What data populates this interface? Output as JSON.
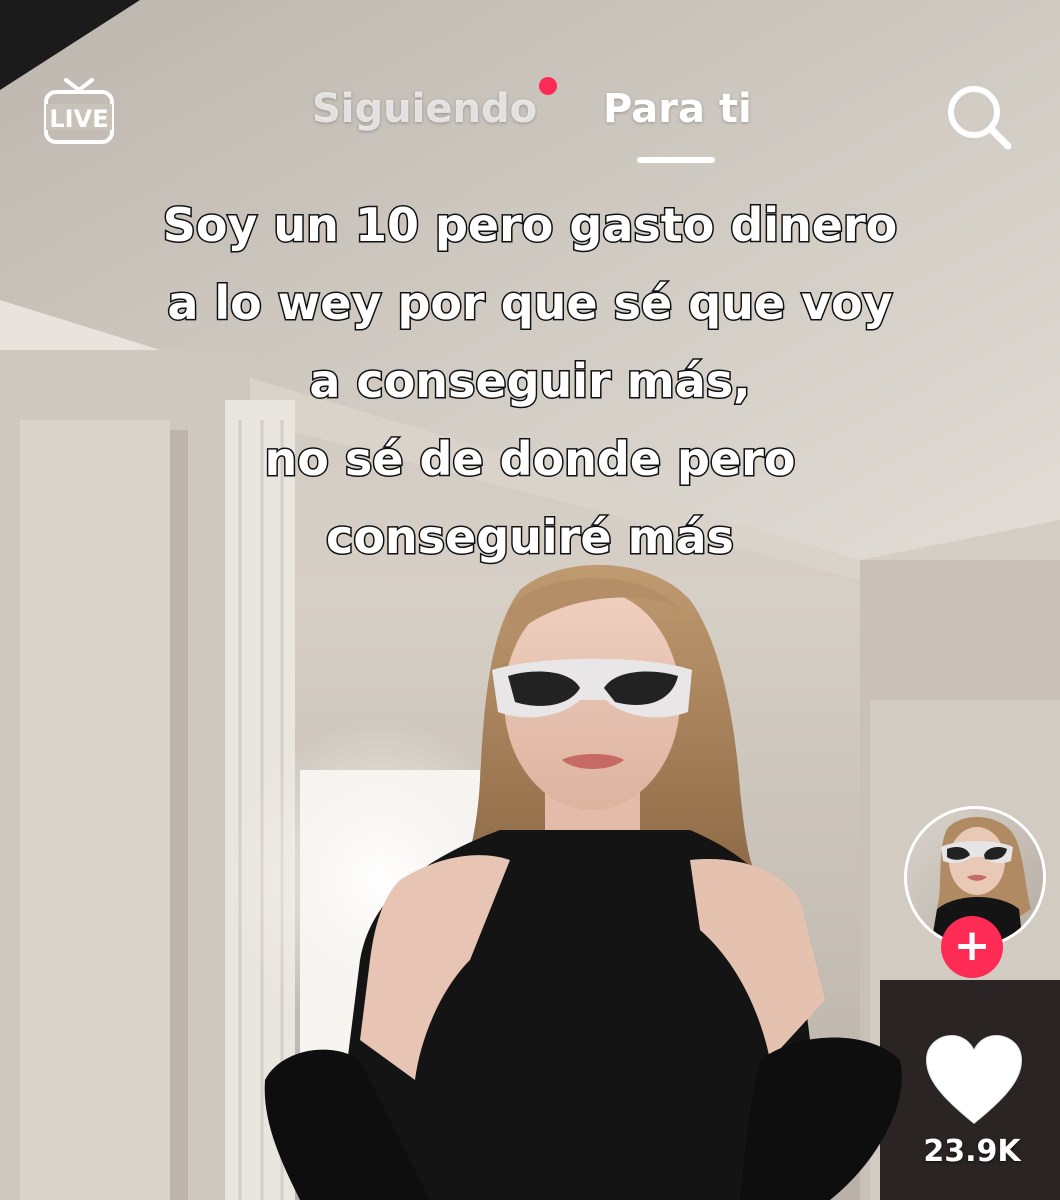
{
  "app": {
    "live_label": "LIVE",
    "tabs": [
      {
        "label": "Siguiendo",
        "active": false,
        "has_notification": true
      },
      {
        "label": "Para ti",
        "active": true
      }
    ],
    "search_icon": "search-icon"
  },
  "video": {
    "caption_lines": [
      "Soy un 10 pero gasto dinero",
      "a lo wey por que sé que voy",
      "a conseguir más,",
      "no sé de donde pero",
      "conseguiré más"
    ]
  },
  "sidebar": {
    "follow_icon": "plus-icon",
    "like_icon": "heart-icon",
    "like_count": "23.9K"
  },
  "colors": {
    "accent": "#fe2c55",
    "text": "#ffffff"
  }
}
